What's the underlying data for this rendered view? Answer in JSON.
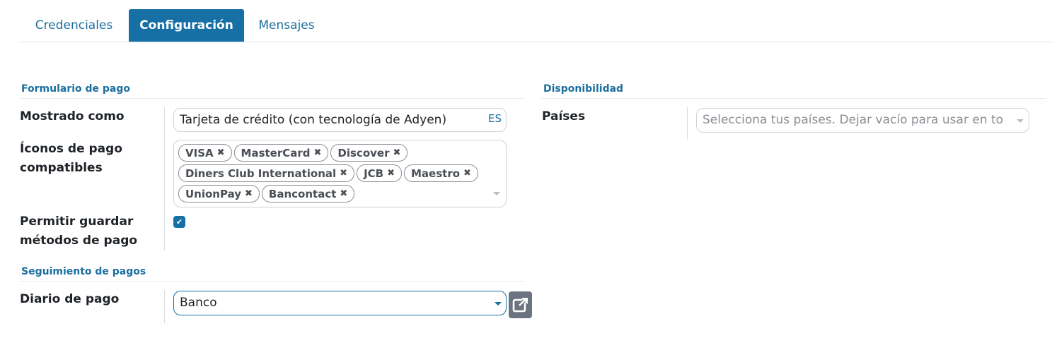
{
  "tabs": [
    {
      "label": "Credenciales",
      "active": false
    },
    {
      "label": "Configuración",
      "active": true
    },
    {
      "label": "Mensajes",
      "active": false
    }
  ],
  "payment_form": {
    "section_title": "Formulario de pago",
    "displayed_as": {
      "label": "Mostrado como",
      "value": "Tarjeta de crédito (con tecnología de Adyen)",
      "lang": "ES"
    },
    "payment_icons": {
      "label_line1": "Íconos de pago",
      "label_line2": "compatibles",
      "rows": [
        [
          "VISA",
          "MasterCard",
          "Discover"
        ],
        [
          "Diners Club International",
          "JCB",
          "Maestro"
        ],
        [
          "UnionPay",
          "Bancontact"
        ]
      ]
    },
    "allow_tokenization": {
      "label_line1": "Permitir guardar",
      "label_line2": "métodos de pago",
      "checked": true
    }
  },
  "payment_followup": {
    "section_title": "Seguimiento de pagos",
    "journal": {
      "label": "Diario de pago",
      "value": "Banco"
    }
  },
  "availability": {
    "section_title": "Disponibilidad",
    "countries": {
      "label": "Países",
      "placeholder": "Selecciona tus países. Dejar vacío para usar en to"
    }
  },
  "colors": {
    "accent": "#1670a5",
    "link": "#1b6e9d",
    "button_gray": "#6b7280"
  },
  "icons": {
    "tag_remove": "times-icon",
    "checkbox": "check-icon",
    "external": "external-link-icon",
    "dropdown": "caret-down-icon"
  }
}
